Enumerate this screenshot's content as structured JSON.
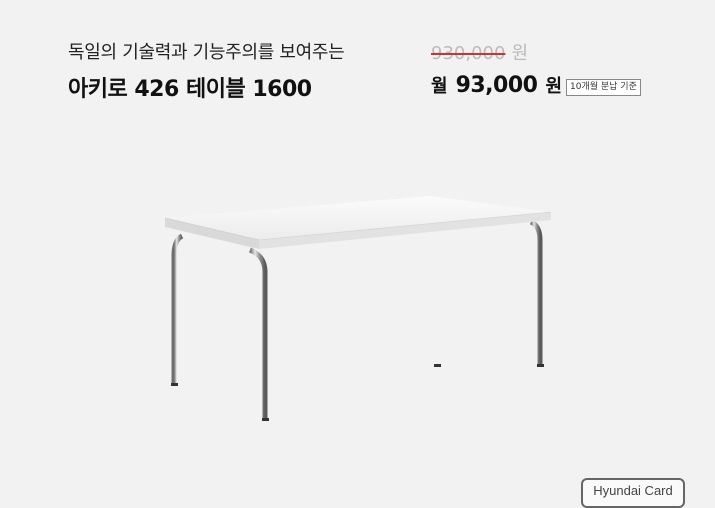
{
  "product": {
    "subtitle": "독일의 기술력과 기능주의를 보여주는",
    "name": "아키로 426 테이블 1600"
  },
  "pricing": {
    "original_price": "930,000",
    "original_unit": "원",
    "monthly_prefix": "월",
    "monthly_price": "93,000",
    "monthly_unit": "원",
    "basis_badge": "10개월 분납 기준"
  },
  "card_logo": "Hyundai Card",
  "colors": {
    "background": "#f2f2f2",
    "strike": "#c9362f",
    "original_price_text": "#bbbbbb"
  }
}
